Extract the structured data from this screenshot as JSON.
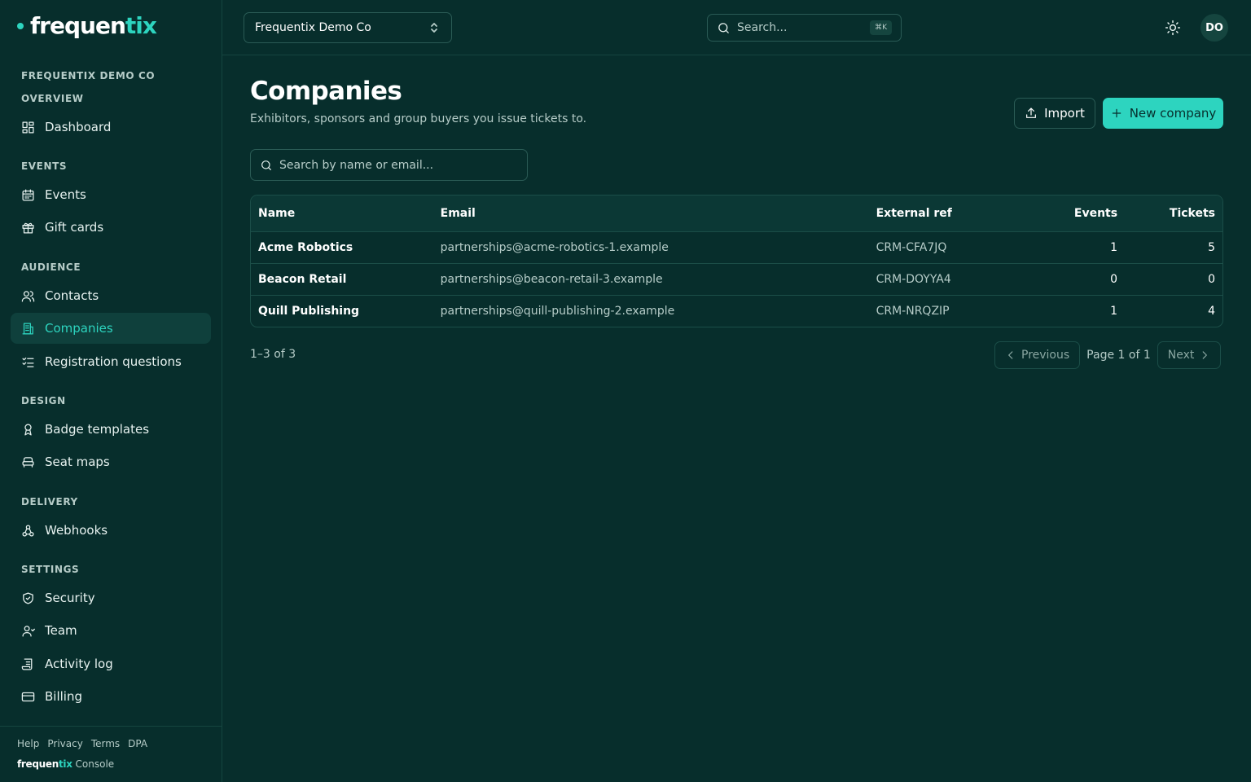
{
  "brand": {
    "name_part1": "frequen",
    "name_part2": "tix",
    "console_label": "Console",
    "accent": "#2dd4bf"
  },
  "sidebar": {
    "org_label": "FREQUENTIX DEMO CO",
    "sections": [
      {
        "label": "OVERVIEW",
        "items": [
          {
            "label": "Dashboard",
            "icon": "dashboard-icon"
          }
        ]
      },
      {
        "label": "EVENTS",
        "items": [
          {
            "label": "Events",
            "icon": "calendar-icon"
          },
          {
            "label": "Gift cards",
            "icon": "gift-icon"
          }
        ]
      },
      {
        "label": "AUDIENCE",
        "items": [
          {
            "label": "Contacts",
            "icon": "users-icon"
          },
          {
            "label": "Companies",
            "icon": "building-icon",
            "active": true
          },
          {
            "label": "Registration questions",
            "icon": "checklist-icon"
          }
        ]
      },
      {
        "label": "DESIGN",
        "items": [
          {
            "label": "Badge templates",
            "icon": "badge-icon"
          },
          {
            "label": "Seat maps",
            "icon": "seat-icon"
          }
        ]
      },
      {
        "label": "DELIVERY",
        "items": [
          {
            "label": "Webhooks",
            "icon": "webhook-icon"
          }
        ]
      },
      {
        "label": "SETTINGS",
        "items": [
          {
            "label": "Security",
            "icon": "shield-icon"
          },
          {
            "label": "Team",
            "icon": "user-icon"
          },
          {
            "label": "Activity log",
            "icon": "log-icon"
          },
          {
            "label": "Billing",
            "icon": "credit-card-icon"
          }
        ]
      }
    ],
    "footer_links": [
      "Help",
      "Privacy",
      "Terms",
      "DPA"
    ]
  },
  "topbar": {
    "org_switcher": "Frequentix Demo Co",
    "search_placeholder": "Search...",
    "search_shortcut": "⌘K",
    "avatar_initials": "DO"
  },
  "page": {
    "title": "Companies",
    "subtitle": "Exhibitors, sponsors and group buyers you issue tickets to.",
    "import_label": "Import",
    "new_label": "New company",
    "search_placeholder": "Search by name or email..."
  },
  "table": {
    "columns": {
      "name": "Name",
      "email": "Email",
      "ref": "External ref",
      "events": "Events",
      "tickets": "Tickets"
    },
    "rows": [
      {
        "name": "Acme Robotics",
        "email": "partnerships@acme-robotics-1.example",
        "ref": "CRM-CFA7JQ",
        "events": "1",
        "tickets": "5"
      },
      {
        "name": "Beacon Retail",
        "email": "partnerships@beacon-retail-3.example",
        "ref": "CRM-DOYYA4",
        "events": "0",
        "tickets": "0"
      },
      {
        "name": "Quill Publishing",
        "email": "partnerships@quill-publishing-2.example",
        "ref": "CRM-NRQZIP",
        "events": "1",
        "tickets": "4"
      }
    ]
  },
  "pagination": {
    "count": "1–3 of 3",
    "previous": "Previous",
    "page_info": "Page 1 of 1",
    "next": "Next"
  }
}
